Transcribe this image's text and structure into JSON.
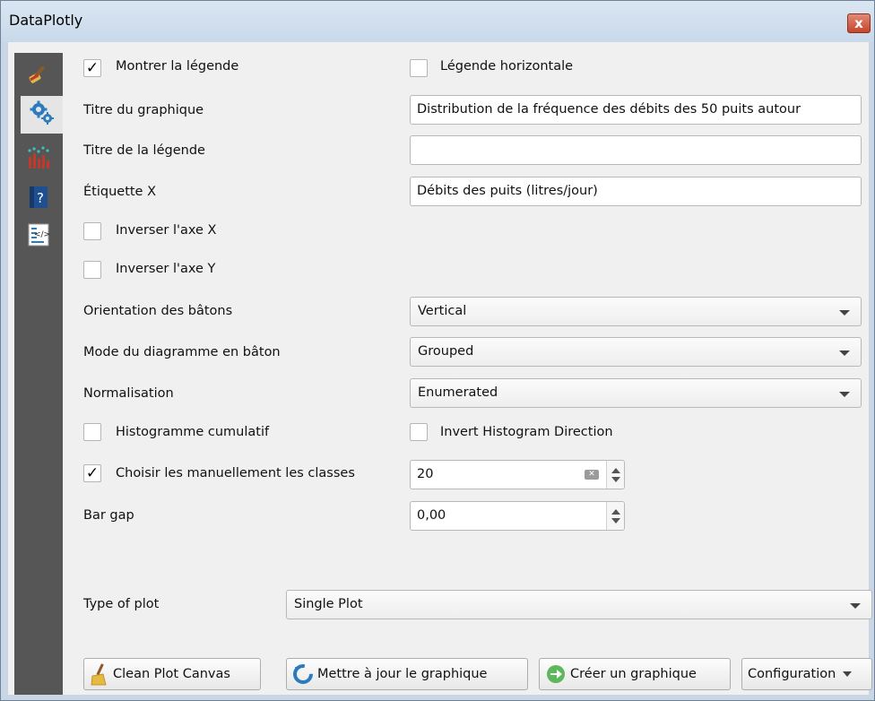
{
  "window": {
    "title": "DataPlotly",
    "close_label": "x"
  },
  "sidebar": {
    "items": [
      {
        "name": "style-brush-icon"
      },
      {
        "name": "settings-gears-icon"
      },
      {
        "name": "plot-chart-icon"
      },
      {
        "name": "help-icon"
      },
      {
        "name": "code-icon"
      }
    ]
  },
  "form": {
    "show_legend": {
      "label": "Montrer la légende",
      "checked": true
    },
    "horizontal_legend": {
      "label": "Légende horizontale",
      "checked": false
    },
    "plot_title": {
      "label": "Titre du graphique",
      "value": "Distribution de la fréquence des débits des 50 puits autour"
    },
    "legend_title": {
      "label": "Titre de la légende",
      "value": ""
    },
    "x_label": {
      "label": "Étiquette X",
      "value": "Débits des puits (litres/jour)"
    },
    "invert_x": {
      "label": "Inverser l'axe X",
      "checked": false
    },
    "invert_y": {
      "label": "Inverser l'axe Y",
      "checked": false
    },
    "bar_orientation": {
      "label": "Orientation des bâtons",
      "value": "Vertical"
    },
    "bar_mode": {
      "label": "Mode du diagramme en bâton",
      "value": "Grouped"
    },
    "normalization": {
      "label": "Normalisation",
      "value": "Enumerated"
    },
    "cumulative": {
      "label": "Histogramme cumulatif",
      "checked": false
    },
    "invert_direction": {
      "label": "Invert Histogram Direction",
      "checked": false
    },
    "manual_bins": {
      "label": "Choisir les manuellement les classes",
      "checked": true,
      "value": "20"
    },
    "bar_gap": {
      "label": "Bar gap",
      "value": "0,00"
    },
    "plot_type": {
      "label": "Type of plot",
      "value": "Single Plot"
    }
  },
  "buttons": {
    "clean": "Clean Plot Canvas",
    "update": "Mettre à jour le graphique",
    "create": "Créer un graphique",
    "configuration": "Configuration"
  },
  "check_mark": "✓"
}
